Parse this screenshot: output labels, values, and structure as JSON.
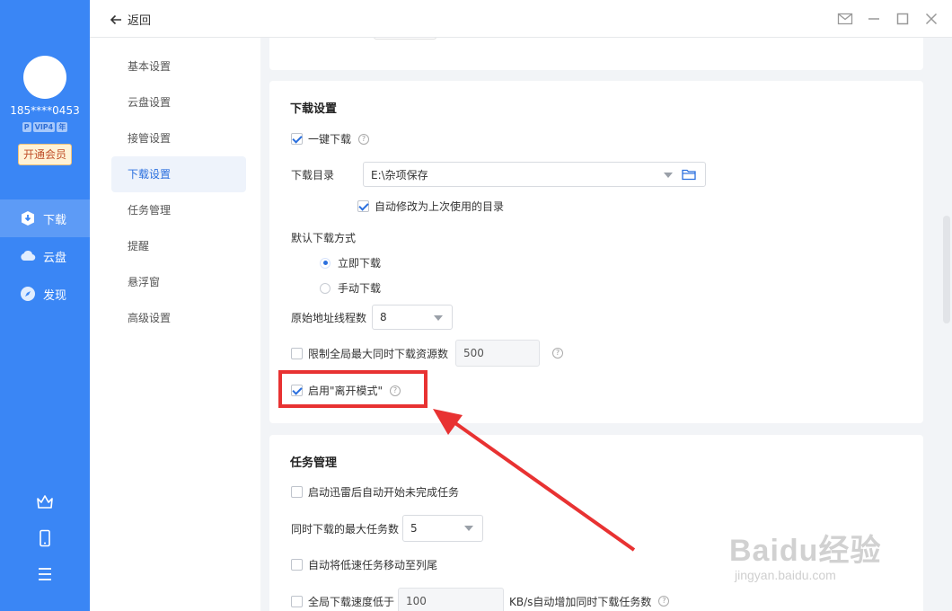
{
  "user": {
    "name": "185****0453",
    "badges": [
      "P",
      "VIP4",
      "年"
    ],
    "vip_button": "开通会员"
  },
  "side_nav": [
    {
      "label": "下载",
      "icon": "download-icon",
      "active": true
    },
    {
      "label": "云盘",
      "icon": "cloud-icon",
      "active": false
    },
    {
      "label": "发现",
      "icon": "compass-icon",
      "active": false
    }
  ],
  "topbar": {
    "back_label": "返回"
  },
  "settings_nav": [
    {
      "label": "基本设置"
    },
    {
      "label": "云盘设置"
    },
    {
      "label": "接管设置"
    },
    {
      "label": "下载设置",
      "active": true
    },
    {
      "label": "任务管理"
    },
    {
      "label": "提醒"
    },
    {
      "label": "悬浮窗"
    },
    {
      "label": "高级设置"
    }
  ],
  "download_settings": {
    "title": "下载设置",
    "one_click": {
      "label": "一键下载",
      "checked": true
    },
    "dir_label": "下载目录",
    "dir_value": "E:\\杂项保存",
    "auto_modify": {
      "label": "自动修改为上次使用的目录",
      "checked": true
    },
    "default_mode_label": "默认下载方式",
    "mode_options": [
      {
        "label": "立即下载",
        "checked": true
      },
      {
        "label": "手动下载",
        "checked": false
      }
    ],
    "threads_label": "原始地址线程数",
    "threads_value": "8",
    "limit": {
      "label": "限制全局最大同时下载资源数",
      "checked": false,
      "value": "500"
    },
    "away_mode": {
      "label": "启用\"离开模式\"",
      "checked": true
    }
  },
  "task_management": {
    "title": "任务管理",
    "auto_start": {
      "label": "启动迅雷后自动开始未完成任务",
      "checked": false
    },
    "max_tasks_label": "同时下载的最大任务数",
    "max_tasks_value": "5",
    "move_slow": {
      "label": "自动将低速任务移动至列尾",
      "checked": false
    },
    "speed_low": {
      "label": "全局下载速度低于",
      "checked": false,
      "value": "100",
      "suffix": "KB/s自动增加同时下载任务数"
    }
  },
  "watermark": {
    "text": "Baidu经验",
    "sub": "jingyan.baidu.com"
  },
  "colors": {
    "sidebar": "#3a86f5",
    "accent": "#2a6fde",
    "highlight": "#e83232"
  }
}
